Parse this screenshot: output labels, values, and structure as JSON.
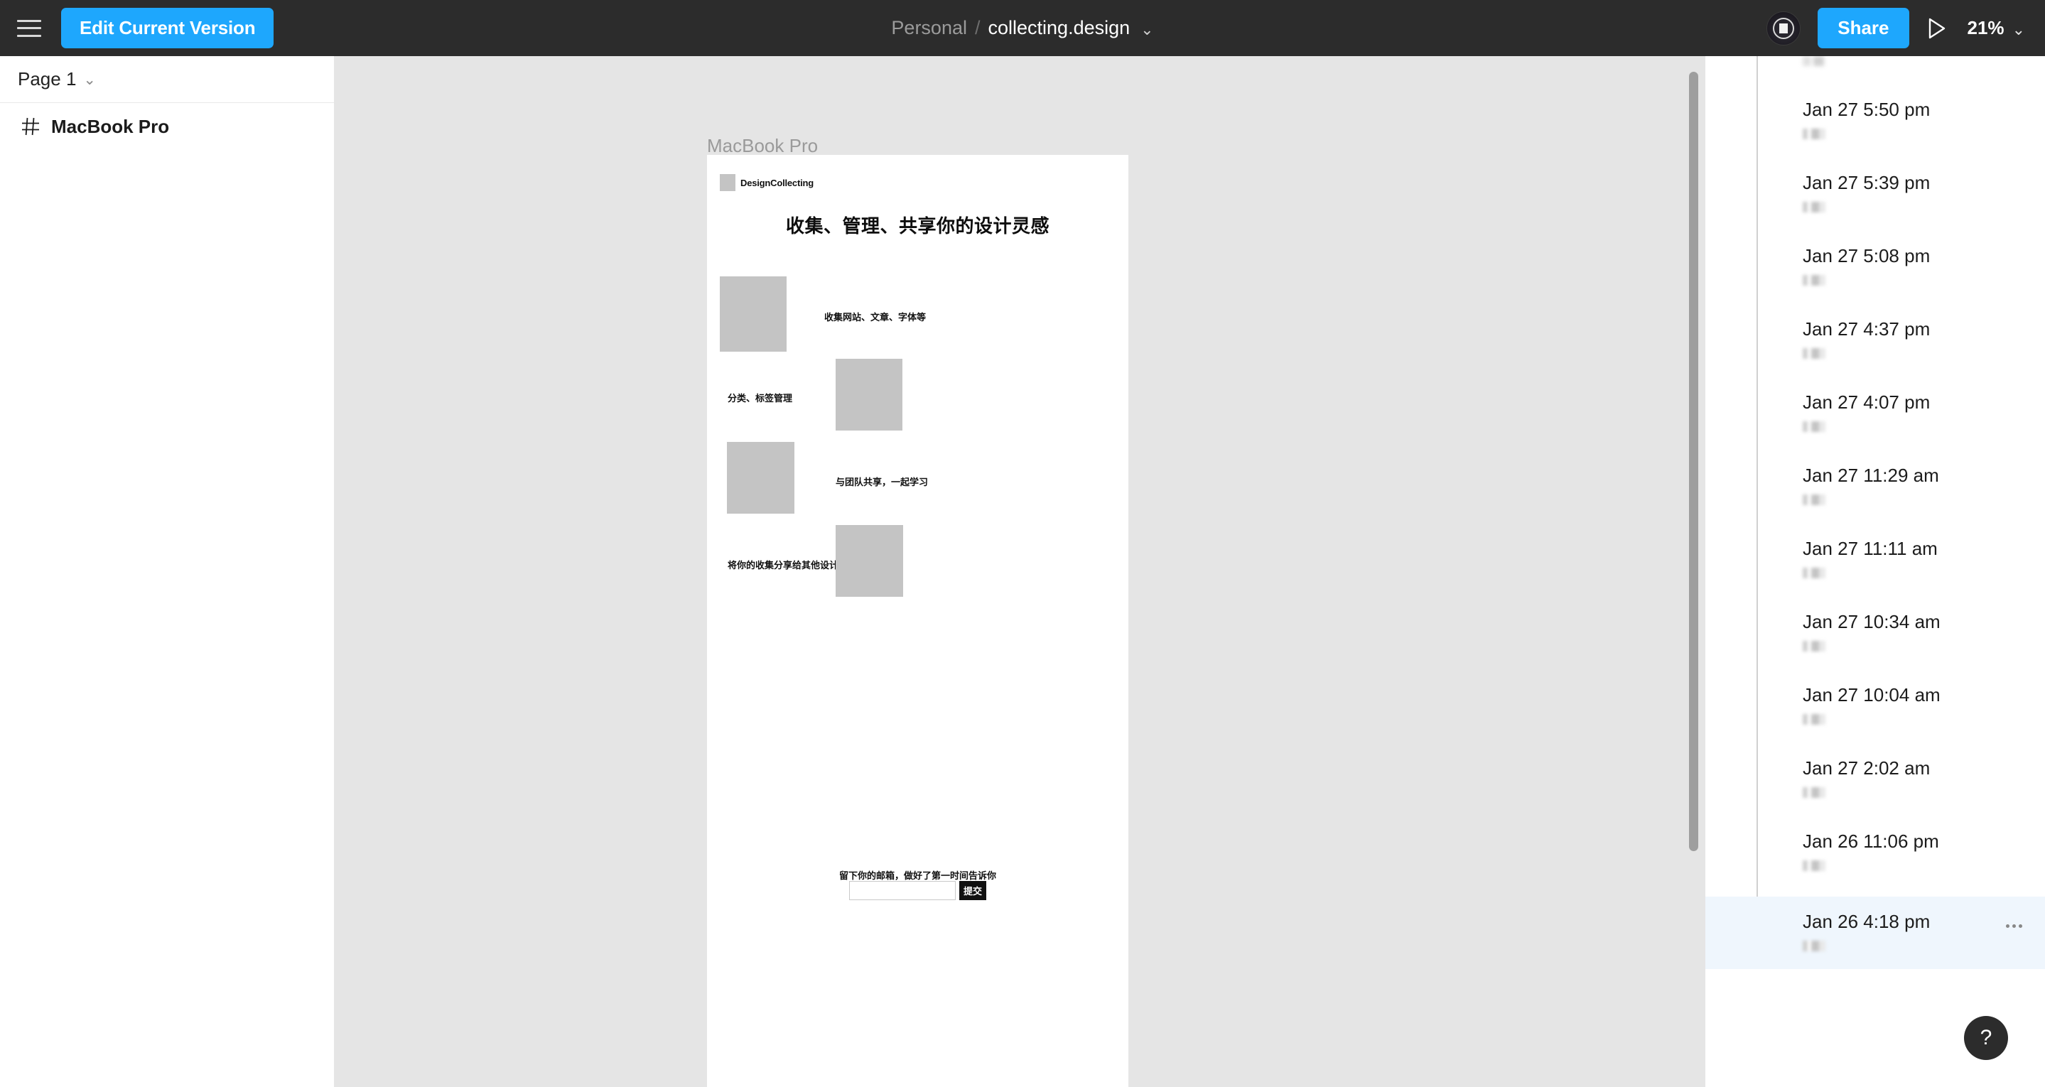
{
  "topbar": {
    "menu_icon": "hamburger-menu-icon",
    "edit_version_label": "Edit Current Version",
    "breadcrumb": {
      "team": "Personal",
      "separator": "/",
      "file": "collecting.design",
      "caret": "⌄"
    },
    "share_label": "Share",
    "present_icon": "play-triangle-icon",
    "zoom_level": "21%",
    "zoom_caret": "⌄",
    "avatar_icon": "user-avatar",
    "accent_color": "#1ea7fd",
    "background_color": "#2c2c2c"
  },
  "sidebar": {
    "page_label": "Page 1",
    "page_caret": "⌄",
    "layers": [
      {
        "icon": "frame-icon",
        "label": "MacBook Pro"
      }
    ]
  },
  "canvas": {
    "frame_label": "MacBook Pro",
    "background_color": "#e5e5e5",
    "artboard": {
      "logo_text": "DesignCollecting",
      "hero_heading": "收集、管理、共享你的设计灵感",
      "features": [
        {
          "caption": "收集网站、文章、字体等",
          "image_side": "left"
        },
        {
          "caption": "分类、标签管理",
          "image_side": "right"
        },
        {
          "caption": "与团队共享，一起学习",
          "image_side": "left"
        },
        {
          "caption": "将你的收集分享给其他设计师",
          "image_side": "right"
        }
      ],
      "signup_label": "留下你的邮箱，做好了第一时间告诉你",
      "email_value": "",
      "email_placeholder": "",
      "submit_label": "提交"
    }
  },
  "history": {
    "selected_color": "#eff6fd",
    "items": [
      {
        "time": "Jan 27 5:50 pm",
        "author": "",
        "selected": false
      },
      {
        "time": "Jan 27 5:39 pm",
        "author": "",
        "selected": false
      },
      {
        "time": "Jan 27 5:08 pm",
        "author": "",
        "selected": false
      },
      {
        "time": "Jan 27 4:37 pm",
        "author": "",
        "selected": false
      },
      {
        "time": "Jan 27 4:07 pm",
        "author": "",
        "selected": false
      },
      {
        "time": "Jan 27 11:29 am",
        "author": "",
        "selected": false
      },
      {
        "time": "Jan 27 11:11 am",
        "author": "",
        "selected": false
      },
      {
        "time": "Jan 27 10:34 am",
        "author": "",
        "selected": false
      },
      {
        "time": "Jan 27 10:04 am",
        "author": "",
        "selected": false
      },
      {
        "time": "Jan 27 2:02 am",
        "author": "",
        "selected": false
      },
      {
        "time": "Jan 26 11:06 pm",
        "author": "",
        "selected": false
      },
      {
        "time": "Jan 26 4:18 pm",
        "author": "",
        "selected": true
      }
    ]
  },
  "help": {
    "label": "?"
  }
}
